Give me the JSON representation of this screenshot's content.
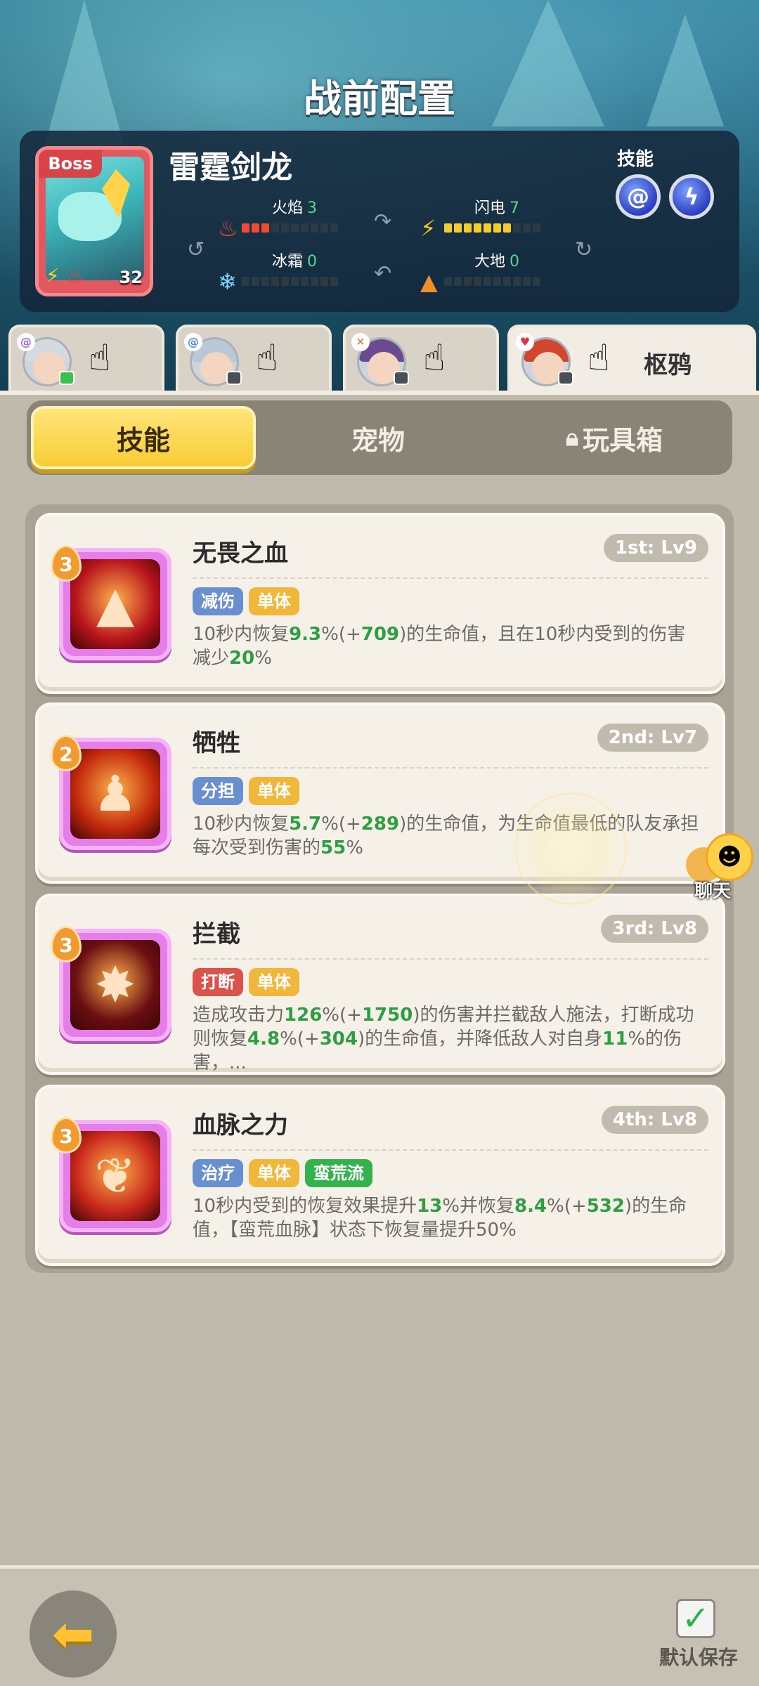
{
  "header": {
    "title": "战前配置"
  },
  "boss": {
    "badge": "Boss",
    "name": "雷霆剑龙",
    "level": "32",
    "stats": [
      {
        "label": "火焰",
        "value": "3",
        "filled": 3,
        "color": "#f04a34",
        "icon": "fire-icon"
      },
      {
        "label": "闪电",
        "value": "7",
        "filled": 7,
        "color": "#f3cd2d",
        "icon": "lightning-icon"
      },
      {
        "label": "冰霜",
        "value": "0",
        "filled": 0,
        "color": "#7fd6ff",
        "icon": "snowflake-icon"
      },
      {
        "label": "大地",
        "value": "0",
        "filled": 0,
        "color": "#f0902b",
        "icon": "mountain-icon"
      }
    ],
    "skills_label": "技能"
  },
  "heroes": [
    {
      "name": "",
      "active": false
    },
    {
      "name": "",
      "active": false
    },
    {
      "name": "",
      "active": false
    },
    {
      "name": "枢鸦",
      "active": true
    }
  ],
  "tabs": [
    {
      "label": "技能",
      "active": true
    },
    {
      "label": "宠物",
      "active": false
    },
    {
      "label": "玩具箱",
      "active": false,
      "locked": true
    }
  ],
  "skills": [
    {
      "rank": "3",
      "title": "无畏之血",
      "level": "1st: Lv9",
      "tags": [
        {
          "text": "减伤",
          "color": "blue"
        },
        {
          "text": "单体",
          "color": "yellow"
        }
      ],
      "desc_parts": [
        "10秒内恢复",
        "9.3",
        "%(+",
        "709",
        ")的生命值，且在10秒内受到的伤害减少",
        "20",
        "%"
      ],
      "icon_bg": "#b8141d",
      "icon_glyph": "▲"
    },
    {
      "rank": "2",
      "title": "牺牲",
      "level": "2nd: Lv7",
      "tags": [
        {
          "text": "分担",
          "color": "blue"
        },
        {
          "text": "单体",
          "color": "yellow"
        }
      ],
      "desc_parts": [
        "10秒内恢复",
        "5.7",
        "%(+",
        "289",
        ")的生命值，为生命值最低的队友承担每次受到伤害的",
        "55",
        "%"
      ],
      "icon_bg": "#c2280c",
      "icon_glyph": "♟"
    },
    {
      "rank": "3",
      "title": "拦截",
      "level": "3rd: Lv8",
      "tags": [
        {
          "text": "打断",
          "color": "red"
        },
        {
          "text": "单体",
          "color": "yellow"
        }
      ],
      "desc_parts": [
        "造成攻击力",
        "126",
        "%(+",
        "1750",
        ")的伤害并拦截敌人施法，打断成功则恢复",
        "4.8",
        "%(+",
        "304",
        ")的生命值，并降低敌人对自身",
        "11",
        "%的伤害，..."
      ],
      "icon_bg": "#6b0e12",
      "icon_glyph": "✸"
    },
    {
      "rank": "3",
      "title": "血脉之力",
      "level": "4th: Lv8",
      "tags": [
        {
          "text": "治疗",
          "color": "blue"
        },
        {
          "text": "单体",
          "color": "yellow"
        },
        {
          "text": "蛮荒流",
          "color": "green"
        }
      ],
      "desc_parts": [
        "10秒内受到的恢复效果提升",
        "13",
        "%并恢复",
        "8.4",
        "%(+",
        "532",
        ")的生命值，【蛮荒血脉】状态下恢复量提升50%"
      ],
      "icon_bg": "#c7261b",
      "icon_glyph": "❦"
    }
  ],
  "chat": {
    "label": "聊天"
  },
  "footer": {
    "save_label": "默认保存",
    "back_icon": "back-arrow-icon"
  }
}
